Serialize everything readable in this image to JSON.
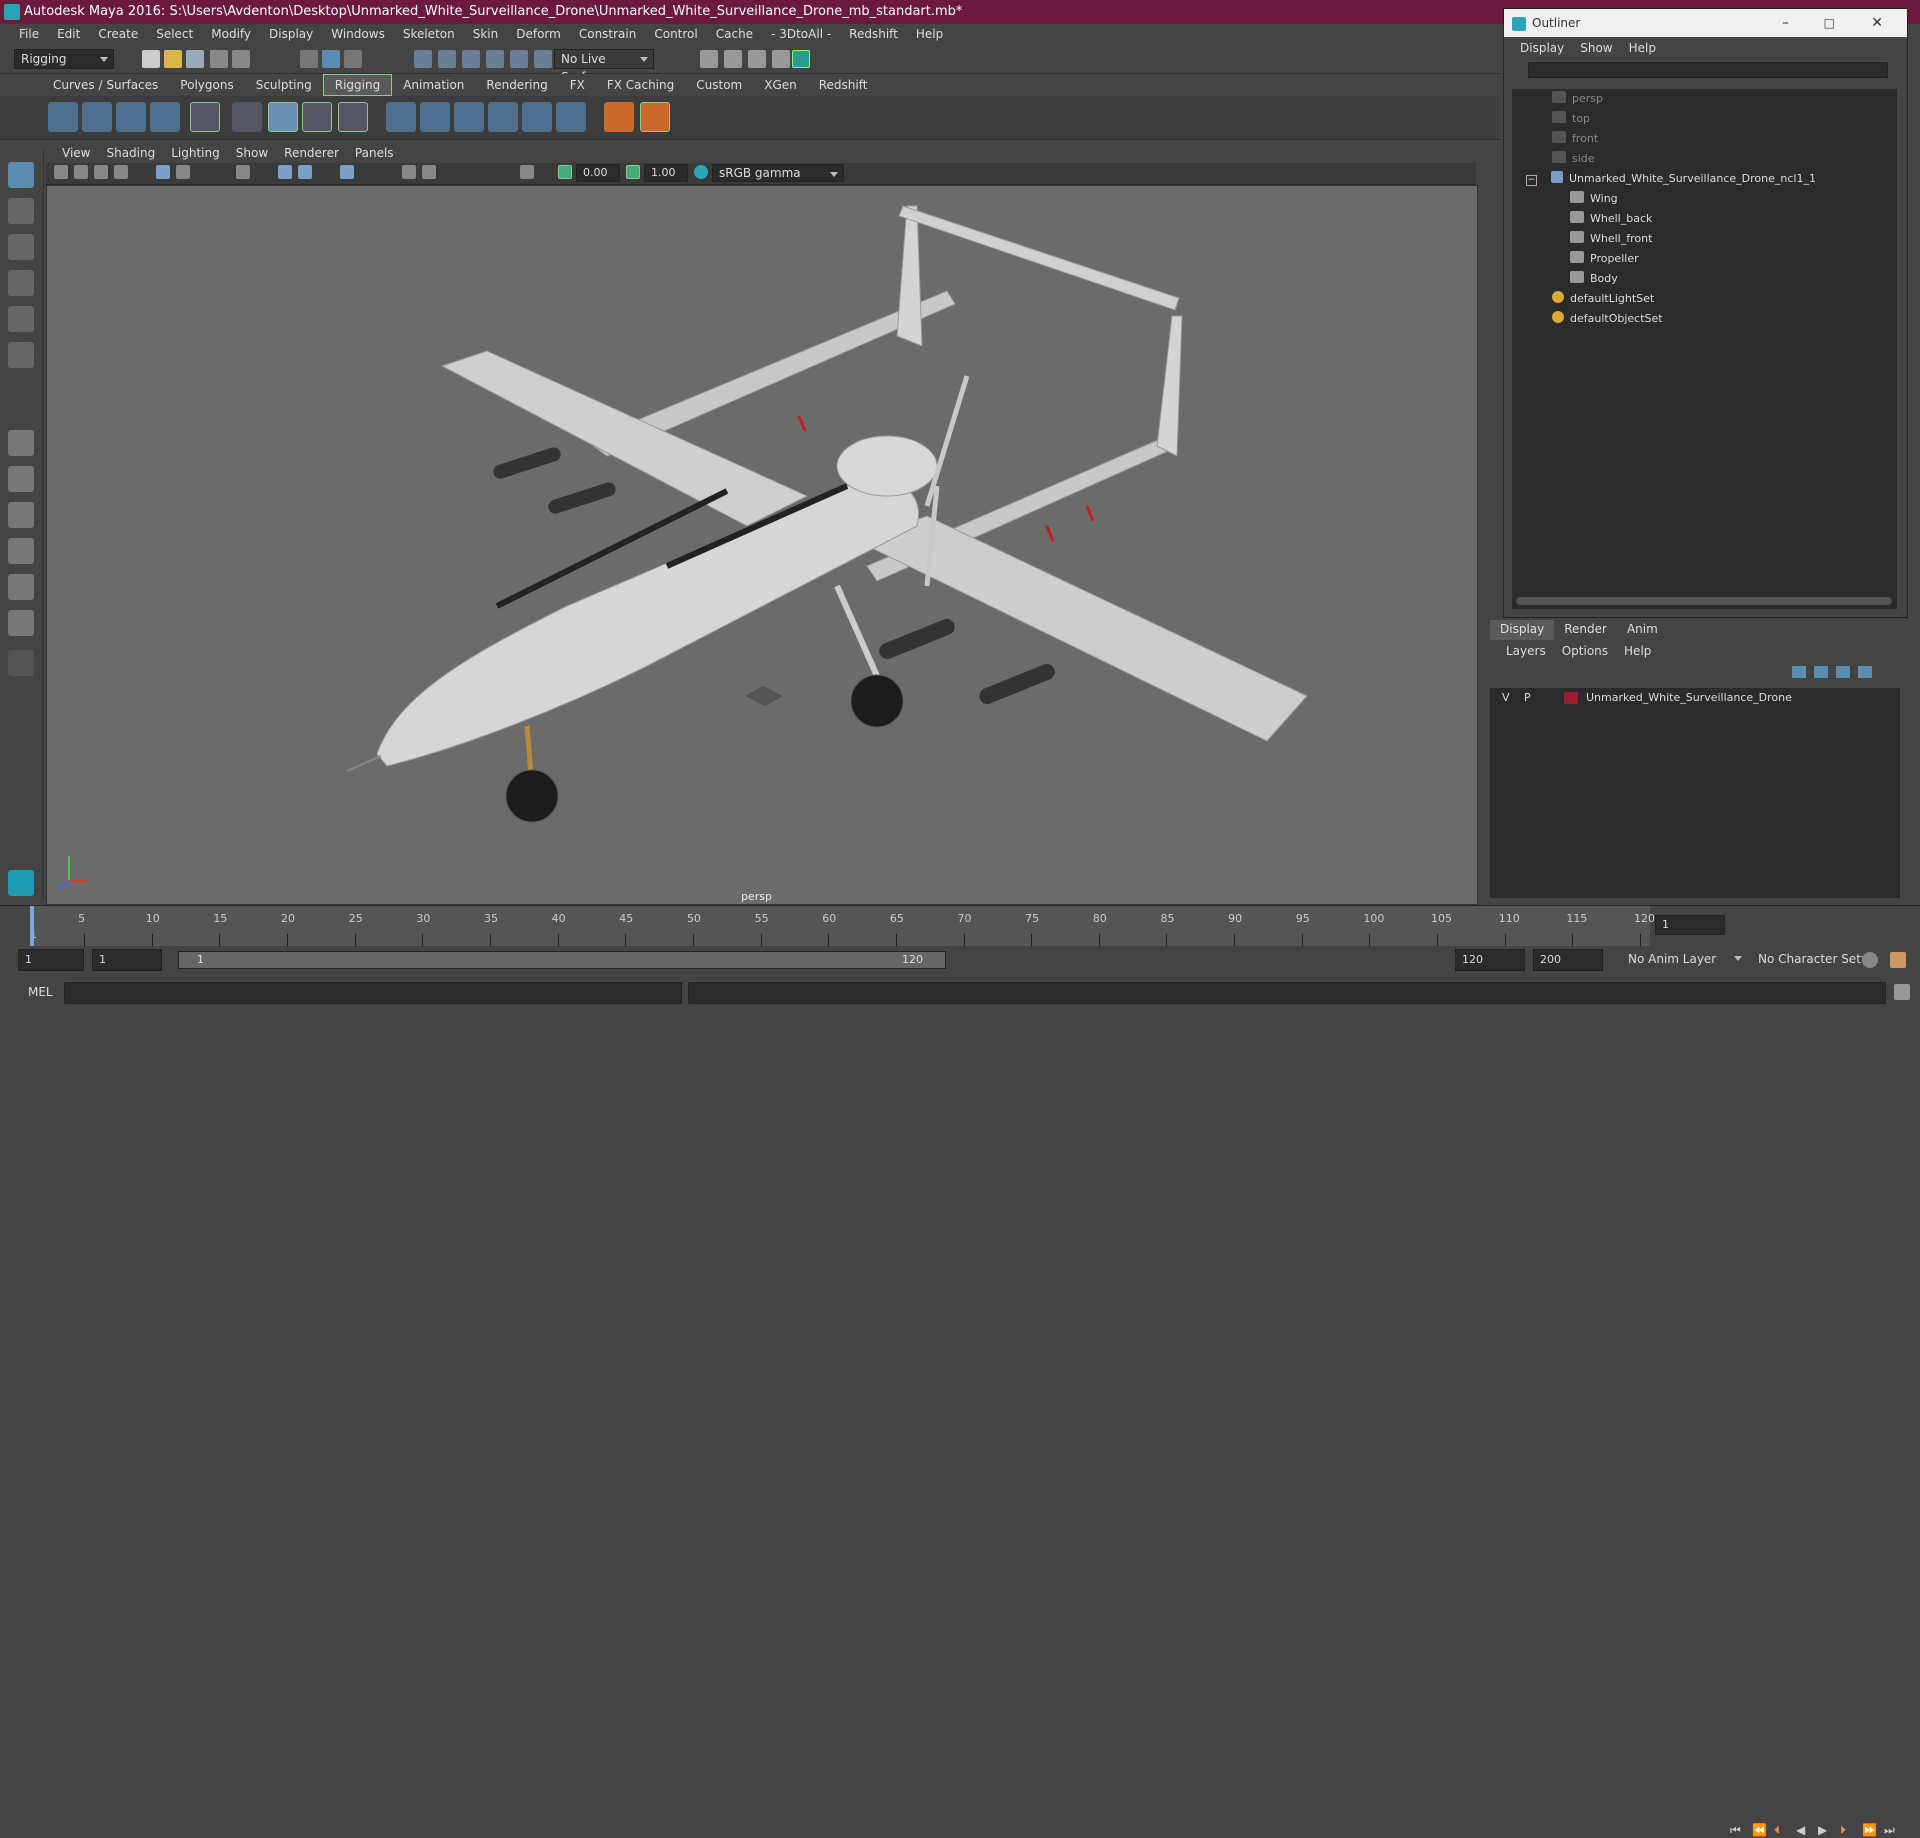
{
  "title": "Autodesk Maya 2016: S:\\Users\\Avdenton\\Desktop\\Unmarked_White_Surveillance_Drone\\Unmarked_White_Surveillance_Drone_mb_standart.mb*",
  "menubar": [
    "File",
    "Edit",
    "Create",
    "Select",
    "Modify",
    "Display",
    "Windows",
    "Skeleton",
    "Skin",
    "Deform",
    "Constrain",
    "Control",
    "Cache",
    "- 3DtoAll -",
    "Redshift",
    "Help"
  ],
  "status": {
    "mode": "Rigging",
    "live_surface": "No Live Surface"
  },
  "shelf_tabs": [
    "Curves / Surfaces",
    "Polygons",
    "Sculpting",
    "Rigging",
    "Animation",
    "Rendering",
    "FX",
    "FX Caching",
    "Custom",
    "XGen",
    "Redshift"
  ],
  "shelf_active": "Rigging",
  "panel_menu": [
    "View",
    "Shading",
    "Lighting",
    "Show",
    "Renderer",
    "Panels"
  ],
  "panel_toolbar": {
    "exposure": "0.00",
    "gamma": "1.00",
    "colorspace": "sRGB gamma"
  },
  "viewport_label": "persp",
  "outliner": {
    "title": "Outliner",
    "menu": [
      "Display",
      "Show",
      "Help"
    ],
    "items": [
      {
        "label": "persp",
        "indent": 1,
        "dim": true,
        "icon": "camera-icon"
      },
      {
        "label": "top",
        "indent": 1,
        "dim": true,
        "icon": "camera-icon"
      },
      {
        "label": "front",
        "indent": 1,
        "dim": true,
        "icon": "camera-icon"
      },
      {
        "label": "side",
        "indent": 1,
        "dim": true,
        "icon": "camera-icon"
      },
      {
        "label": "Unmarked_White_Surveillance_Drone_ncl1_1",
        "indent": 1,
        "dim": false,
        "icon": "joint-icon",
        "expand": true
      },
      {
        "label": "Wing",
        "indent": 2,
        "dim": false,
        "icon": "mesh-icon"
      },
      {
        "label": "Whell_back",
        "indent": 2,
        "dim": false,
        "icon": "mesh-icon"
      },
      {
        "label": "Whell_front",
        "indent": 2,
        "dim": false,
        "icon": "mesh-icon"
      },
      {
        "label": "Propeller",
        "indent": 2,
        "dim": false,
        "icon": "mesh-icon"
      },
      {
        "label": "Body",
        "indent": 2,
        "dim": false,
        "icon": "mesh-icon"
      },
      {
        "label": "defaultLightSet",
        "indent": 1,
        "dim": false,
        "icon": "set-icon"
      },
      {
        "label": "defaultObjectSet",
        "indent": 1,
        "dim": false,
        "icon": "set-icon"
      }
    ]
  },
  "layer_editor": {
    "tabs": [
      "Display",
      "Render",
      "Anim"
    ],
    "active_tab": "Display",
    "menu": [
      "Layers",
      "Options",
      "Help"
    ],
    "layers": [
      {
        "v": "V",
        "p": "P",
        "name": "Unmarked_White_Surveillance_Drone",
        "color": "#9b1b30"
      }
    ]
  },
  "timeline": {
    "ticks": [
      "5",
      "10",
      "15",
      "20",
      "25",
      "30",
      "35",
      "40",
      "45",
      "50",
      "55",
      "60",
      "65",
      "70",
      "75",
      "80",
      "85",
      "90",
      "95",
      "100",
      "105",
      "110",
      "115",
      "120"
    ],
    "start_marker": "1",
    "current_frame": "1"
  },
  "range": {
    "start": "1",
    "start2": "1",
    "slider_start": "1",
    "slider_end": "120",
    "end": "120",
    "end2": "200",
    "anim_layer": "No Anim Layer",
    "character_set": "No Character Set"
  },
  "cmdline": {
    "label": "MEL"
  },
  "colors": {
    "title_bg": "#6b1a3e",
    "accent": "#2aa5b5",
    "layer_color": "#9b1b30"
  }
}
